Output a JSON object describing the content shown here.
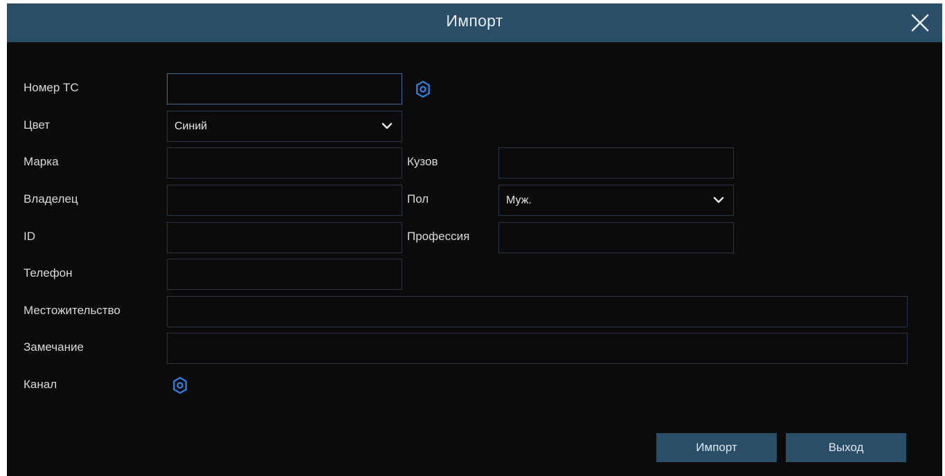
{
  "dialog": {
    "title": "Импорт",
    "close_icon": "close-icon"
  },
  "form": {
    "plate": {
      "label": "Номер ТС",
      "value": "",
      "icon": "gear-icon"
    },
    "color": {
      "label": "Цвет",
      "value": "Синий"
    },
    "brand": {
      "label": "Марка",
      "value": ""
    },
    "body": {
      "label": "Кузов",
      "value": ""
    },
    "owner": {
      "label": "Владелец",
      "value": ""
    },
    "gender": {
      "label": "Пол",
      "value": "Муж."
    },
    "id": {
      "label": "ID",
      "value": ""
    },
    "profession": {
      "label": "Профессия",
      "value": ""
    },
    "phone": {
      "label": "Телефон",
      "value": ""
    },
    "address": {
      "label": "Местожительство",
      "value": ""
    },
    "note": {
      "label": "Замечание",
      "value": ""
    },
    "channel": {
      "label": "Канал",
      "icon": "gear-icon"
    }
  },
  "buttons": {
    "import_label": "Импорт",
    "exit_label": "Выход"
  },
  "colors": {
    "titlebar": "#2a4d68",
    "background": "#0b0b0c",
    "accent": "#2f7fd8",
    "button": "#2a4d68"
  }
}
